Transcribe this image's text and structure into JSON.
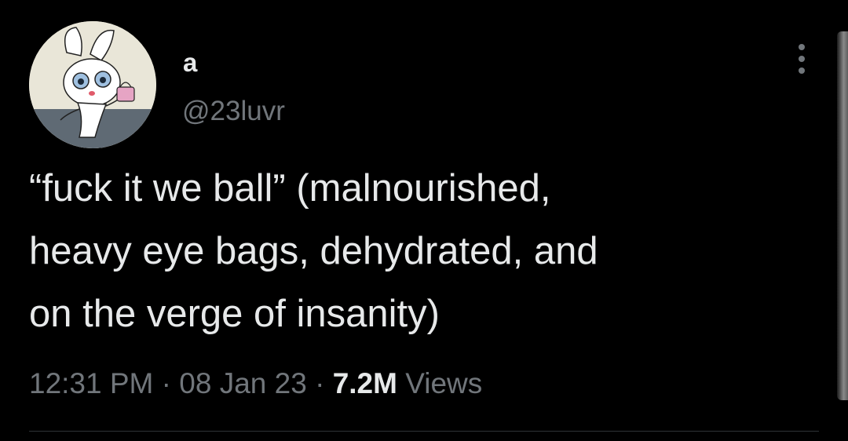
{
  "author": {
    "display_name": "a",
    "handle": "@23luvr",
    "avatar_icon": "cartoon-bunny-avatar"
  },
  "tweet": {
    "text": "“fuck it we ball” (malnourished,\nheavy eye bags, dehydrated, and\non the verge of insanity)",
    "time": "12:31 PM",
    "separator": "·",
    "date": "08 Jan 23",
    "views_count": "7.2M",
    "views_label": "Views"
  },
  "icons": {
    "more": "more-vertical-icon"
  },
  "colors": {
    "background": "#000000",
    "primary_text": "#e7e9ea",
    "secondary_text": "#71767b",
    "divider": "#2f3336"
  }
}
